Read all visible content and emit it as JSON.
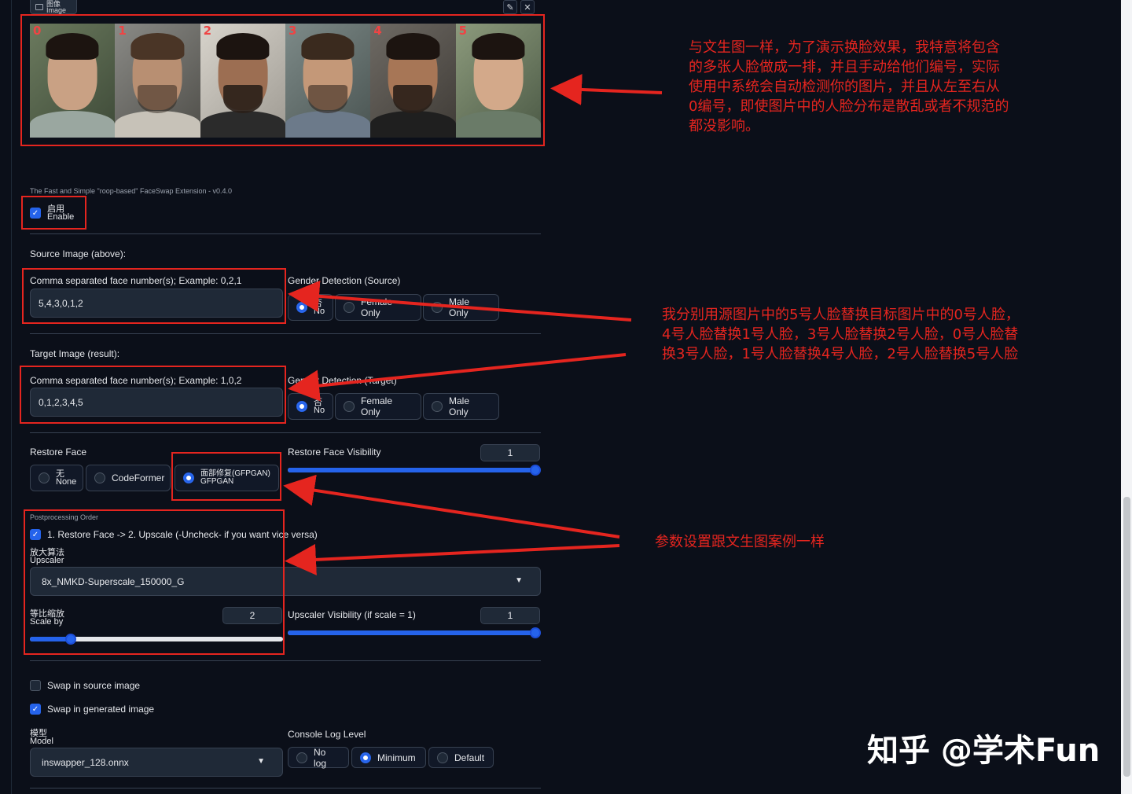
{
  "image_panel": {
    "label_cn": "图像",
    "label_en": "Image",
    "face_numbers": [
      "0",
      "1",
      "2",
      "3",
      "4",
      "5"
    ]
  },
  "extension_title": "The Fast and Simple \"roop-based\" FaceSwap Extension - v0.4.0",
  "enable": {
    "cn": "启用",
    "en": "Enable",
    "checked": true
  },
  "source": {
    "heading": "Source Image (above):",
    "faces_label": "Comma separated face number(s); Example: 0,2,1",
    "faces_value": "5,4,3,0,1,2",
    "gender_label": "Gender Detection (Source)",
    "options": [
      {
        "cn": "否",
        "en": "No",
        "selected": true
      },
      {
        "label": "Female Only",
        "selected": false
      },
      {
        "label": "Male Only",
        "selected": false
      }
    ]
  },
  "target": {
    "heading": "Target Image (result):",
    "faces_label": "Comma separated face number(s); Example: 1,0,2",
    "faces_value": "0,1,2,3,4,5",
    "gender_label": "Gender Detection (Target)",
    "options": [
      {
        "cn": "否",
        "en": "No",
        "selected": true
      },
      {
        "label": "Female Only",
        "selected": false
      },
      {
        "label": "Male Only",
        "selected": false
      }
    ]
  },
  "restore_face": {
    "label": "Restore Face",
    "options": [
      {
        "cn": "无",
        "en": "None",
        "selected": false
      },
      {
        "label": "CodeFormer",
        "selected": false
      },
      {
        "cn": "面部修复(GFPGAN)",
        "en": "GFPGAN",
        "selected": true
      }
    ],
    "visibility_label": "Restore Face Visibility",
    "visibility_value": "1",
    "visibility_fraction": 1.0
  },
  "postprocessing": {
    "order_label": "Postprocessing Order",
    "order_checkbox": "1. Restore Face -> 2. Upscale (-Uncheck- if you want vice versa)",
    "order_checked": true,
    "upscaler_cn": "放大算法",
    "upscaler_en": "Upscaler",
    "upscaler_value": "8x_NMKD-Superscale_150000_G",
    "scale_cn": "等比缩放",
    "scale_en": "Scale by",
    "scale_value": "2",
    "scale_fraction": 0.16,
    "upscaler_visibility_label": "Upscaler Visibility (if scale = 1)",
    "upscaler_visibility_value": "1",
    "upscaler_visibility_fraction": 1.0
  },
  "swap_source": {
    "label": "Swap in source image",
    "checked": false
  },
  "swap_generated": {
    "label": "Swap in generated image",
    "checked": true
  },
  "model": {
    "cn": "模型",
    "en": "Model",
    "value": "inswapper_128.onnx"
  },
  "console_log": {
    "label": "Console Log Level",
    "options": [
      {
        "label": "No log",
        "selected": false
      },
      {
        "label": "Minimum",
        "selected": true
      },
      {
        "label": "Default",
        "selected": false
      }
    ]
  },
  "annotations": {
    "note1": [
      "与文生图一样，为了演示换脸效果，我特意将包含",
      "的多张人脸做成一排，并且手动给他们编号，实际",
      "使用中系统会自动检测你的图片，并且从左至右从",
      "0编号，即使图片中的人脸分布是散乱或者不规范的",
      "都没影响。"
    ],
    "note2": [
      "我分别用源图片中的5号人脸替换目标图片中的0号人脸，",
      "4号人脸替换1号人脸，3号人脸替换2号人脸，0号人脸替",
      "换3号人脸，1号人脸替换4号人脸，2号人脸替换5号人脸"
    ],
    "note3": "参数设置跟文生图案例一样"
  },
  "watermark": "知乎 @学术Fun",
  "colors": {
    "background": "#0b0f19",
    "accent": "#2563eb",
    "annotation": "#e5251f"
  }
}
